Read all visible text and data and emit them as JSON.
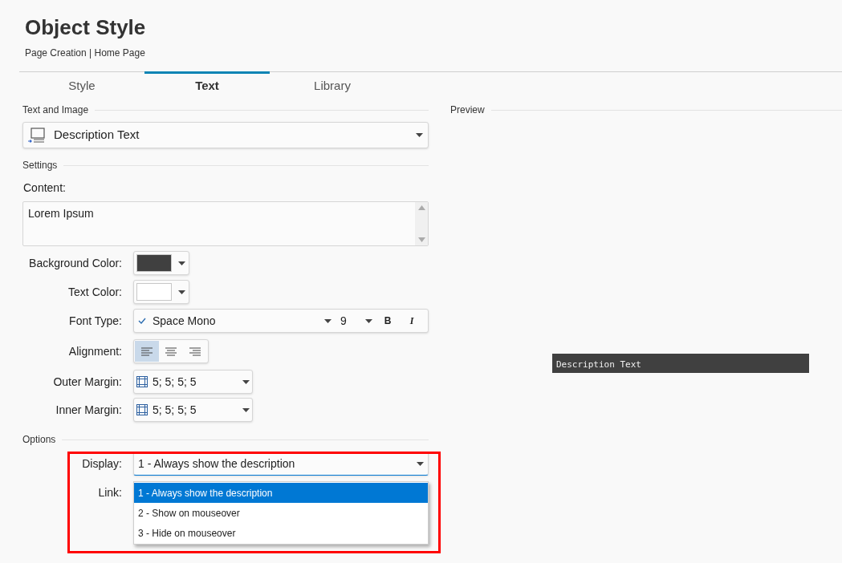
{
  "header": {
    "title": "Object Style",
    "breadcrumb": "Page Creation | Home Page"
  },
  "tabs": [
    {
      "label": "Style",
      "selected": false
    },
    {
      "label": "Text",
      "selected": true
    },
    {
      "label": "Library",
      "selected": false
    }
  ],
  "text_and_image": {
    "heading": "Text and Image",
    "value": "Description Text"
  },
  "settings": {
    "heading": "Settings",
    "content_label": "Content:",
    "content_value": "Lorem Ipsum",
    "background_color": {
      "label": "Background Color:",
      "color": "#404040"
    },
    "text_color": {
      "label": "Text Color:",
      "color": "#ffffff"
    },
    "font_type": {
      "label": "Font Type:",
      "font": "Space Mono",
      "size": "9",
      "bold": "B",
      "italic": "I"
    },
    "alignment": {
      "label": "Alignment:",
      "options": [
        {
          "kind": "left",
          "selected": true
        },
        {
          "kind": "center",
          "selected": false
        },
        {
          "kind": "right",
          "selected": false
        }
      ]
    },
    "outer_margin": {
      "label": "Outer Margin:",
      "value": "5; 5; 5; 5"
    },
    "inner_margin": {
      "label": "Inner Margin:",
      "value": "5; 5; 5; 5"
    }
  },
  "options": {
    "heading": "Options",
    "display_label": "Display:",
    "display_value": "1 - Always show the description",
    "link_label": "Link:",
    "display_options": [
      {
        "label": "1 - Always show the description",
        "selected": true
      },
      {
        "label": "2 - Show on mouseover",
        "selected": false
      },
      {
        "label": "3 - Hide on mouseover",
        "selected": false
      }
    ]
  },
  "preview": {
    "heading": "Preview",
    "sample_text": "Description Text"
  }
}
